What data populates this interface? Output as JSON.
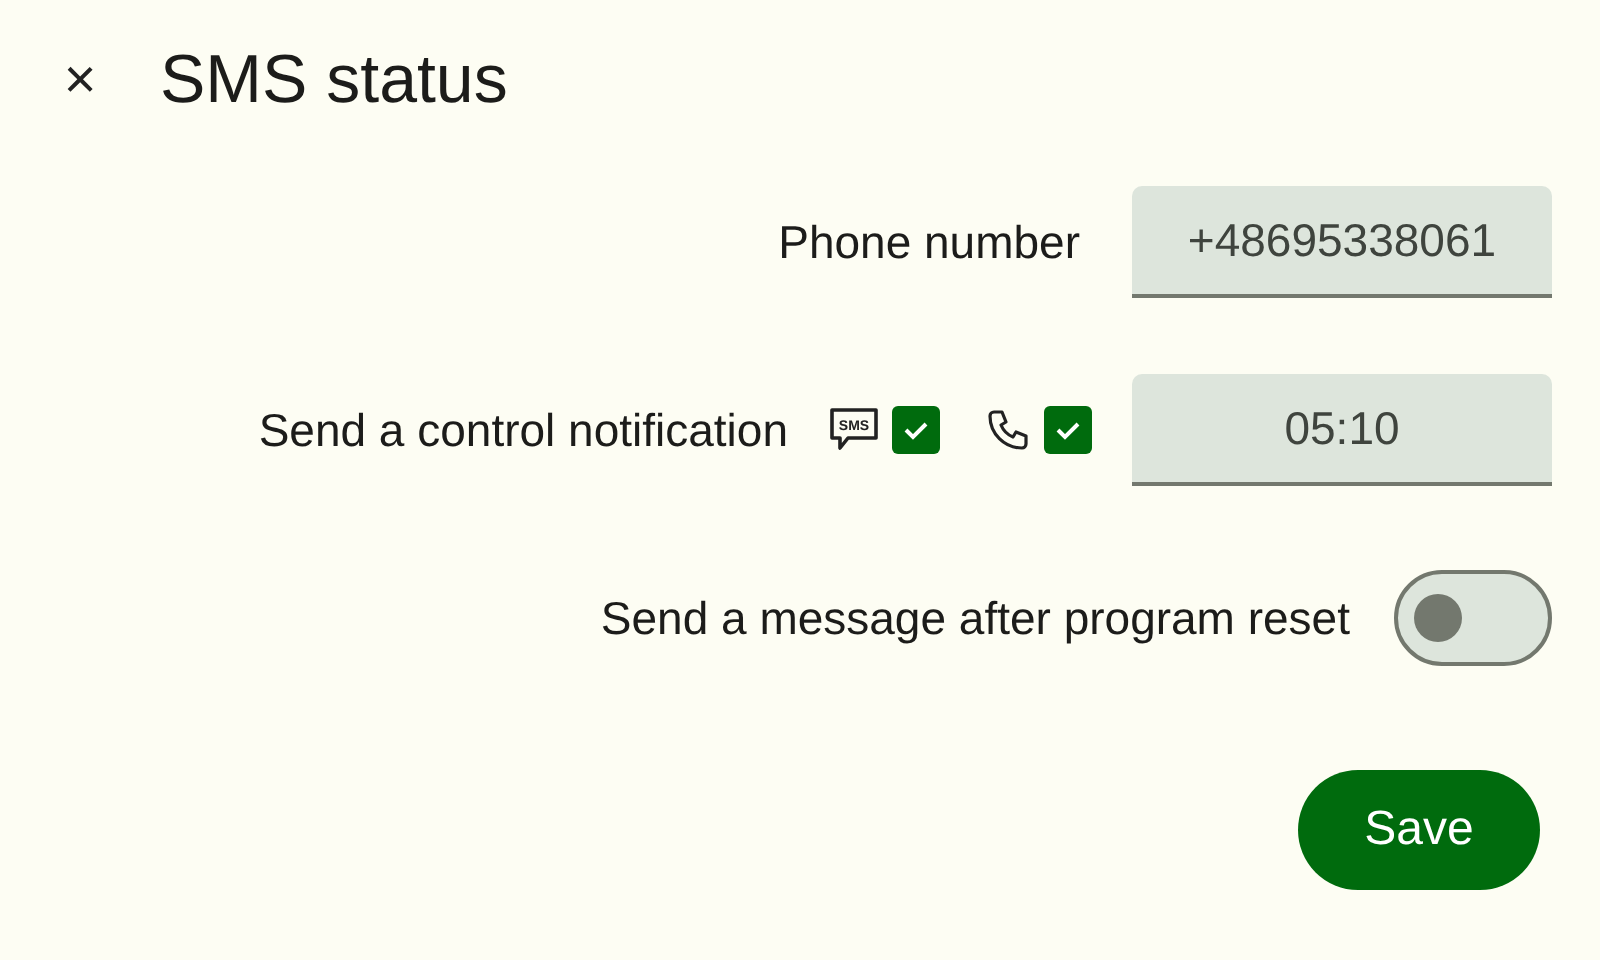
{
  "header": {
    "close": "×",
    "title": "SMS status"
  },
  "phone": {
    "label": "Phone number",
    "value": "+48695338061"
  },
  "notification": {
    "label": "Send a control notification",
    "sms_icon_text": "SMS",
    "sms_checked": true,
    "call_checked": true,
    "time": "05:10"
  },
  "reset": {
    "label": "Send a message after program reset",
    "on": false
  },
  "save": "Save"
}
